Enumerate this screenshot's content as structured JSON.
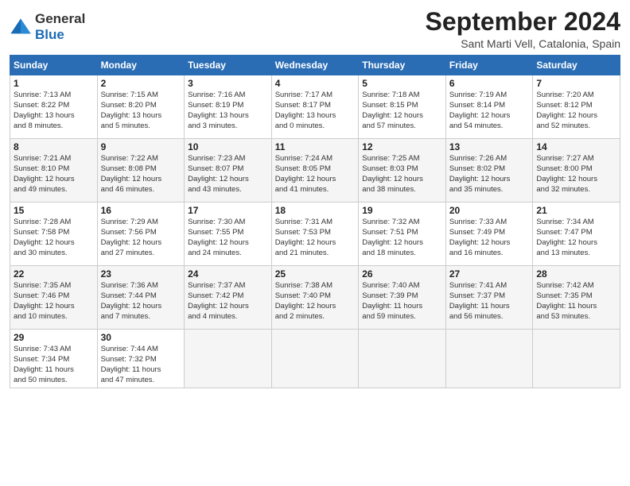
{
  "logo": {
    "line1": "General",
    "line2": "Blue"
  },
  "title": "September 2024",
  "subtitle": "Sant Marti Vell, Catalonia, Spain",
  "header_days": [
    "Sunday",
    "Monday",
    "Tuesday",
    "Wednesday",
    "Thursday",
    "Friday",
    "Saturday"
  ],
  "weeks": [
    [
      {
        "day": "1",
        "info": "Sunrise: 7:13 AM\nSunset: 8:22 PM\nDaylight: 13 hours\nand 8 minutes."
      },
      {
        "day": "2",
        "info": "Sunrise: 7:15 AM\nSunset: 8:20 PM\nDaylight: 13 hours\nand 5 minutes."
      },
      {
        "day": "3",
        "info": "Sunrise: 7:16 AM\nSunset: 8:19 PM\nDaylight: 13 hours\nand 3 minutes."
      },
      {
        "day": "4",
        "info": "Sunrise: 7:17 AM\nSunset: 8:17 PM\nDaylight: 13 hours\nand 0 minutes."
      },
      {
        "day": "5",
        "info": "Sunrise: 7:18 AM\nSunset: 8:15 PM\nDaylight: 12 hours\nand 57 minutes."
      },
      {
        "day": "6",
        "info": "Sunrise: 7:19 AM\nSunset: 8:14 PM\nDaylight: 12 hours\nand 54 minutes."
      },
      {
        "day": "7",
        "info": "Sunrise: 7:20 AM\nSunset: 8:12 PM\nDaylight: 12 hours\nand 52 minutes."
      }
    ],
    [
      {
        "day": "8",
        "info": "Sunrise: 7:21 AM\nSunset: 8:10 PM\nDaylight: 12 hours\nand 49 minutes."
      },
      {
        "day": "9",
        "info": "Sunrise: 7:22 AM\nSunset: 8:08 PM\nDaylight: 12 hours\nand 46 minutes."
      },
      {
        "day": "10",
        "info": "Sunrise: 7:23 AM\nSunset: 8:07 PM\nDaylight: 12 hours\nand 43 minutes."
      },
      {
        "day": "11",
        "info": "Sunrise: 7:24 AM\nSunset: 8:05 PM\nDaylight: 12 hours\nand 41 minutes."
      },
      {
        "day": "12",
        "info": "Sunrise: 7:25 AM\nSunset: 8:03 PM\nDaylight: 12 hours\nand 38 minutes."
      },
      {
        "day": "13",
        "info": "Sunrise: 7:26 AM\nSunset: 8:02 PM\nDaylight: 12 hours\nand 35 minutes."
      },
      {
        "day": "14",
        "info": "Sunrise: 7:27 AM\nSunset: 8:00 PM\nDaylight: 12 hours\nand 32 minutes."
      }
    ],
    [
      {
        "day": "15",
        "info": "Sunrise: 7:28 AM\nSunset: 7:58 PM\nDaylight: 12 hours\nand 30 minutes."
      },
      {
        "day": "16",
        "info": "Sunrise: 7:29 AM\nSunset: 7:56 PM\nDaylight: 12 hours\nand 27 minutes."
      },
      {
        "day": "17",
        "info": "Sunrise: 7:30 AM\nSunset: 7:55 PM\nDaylight: 12 hours\nand 24 minutes."
      },
      {
        "day": "18",
        "info": "Sunrise: 7:31 AM\nSunset: 7:53 PM\nDaylight: 12 hours\nand 21 minutes."
      },
      {
        "day": "19",
        "info": "Sunrise: 7:32 AM\nSunset: 7:51 PM\nDaylight: 12 hours\nand 18 minutes."
      },
      {
        "day": "20",
        "info": "Sunrise: 7:33 AM\nSunset: 7:49 PM\nDaylight: 12 hours\nand 16 minutes."
      },
      {
        "day": "21",
        "info": "Sunrise: 7:34 AM\nSunset: 7:47 PM\nDaylight: 12 hours\nand 13 minutes."
      }
    ],
    [
      {
        "day": "22",
        "info": "Sunrise: 7:35 AM\nSunset: 7:46 PM\nDaylight: 12 hours\nand 10 minutes."
      },
      {
        "day": "23",
        "info": "Sunrise: 7:36 AM\nSunset: 7:44 PM\nDaylight: 12 hours\nand 7 minutes."
      },
      {
        "day": "24",
        "info": "Sunrise: 7:37 AM\nSunset: 7:42 PM\nDaylight: 12 hours\nand 4 minutes."
      },
      {
        "day": "25",
        "info": "Sunrise: 7:38 AM\nSunset: 7:40 PM\nDaylight: 12 hours\nand 2 minutes."
      },
      {
        "day": "26",
        "info": "Sunrise: 7:40 AM\nSunset: 7:39 PM\nDaylight: 11 hours\nand 59 minutes."
      },
      {
        "day": "27",
        "info": "Sunrise: 7:41 AM\nSunset: 7:37 PM\nDaylight: 11 hours\nand 56 minutes."
      },
      {
        "day": "28",
        "info": "Sunrise: 7:42 AM\nSunset: 7:35 PM\nDaylight: 11 hours\nand 53 minutes."
      }
    ],
    [
      {
        "day": "29",
        "info": "Sunrise: 7:43 AM\nSunset: 7:34 PM\nDaylight: 11 hours\nand 50 minutes."
      },
      {
        "day": "30",
        "info": "Sunrise: 7:44 AM\nSunset: 7:32 PM\nDaylight: 11 hours\nand 47 minutes."
      },
      null,
      null,
      null,
      null,
      null
    ]
  ]
}
